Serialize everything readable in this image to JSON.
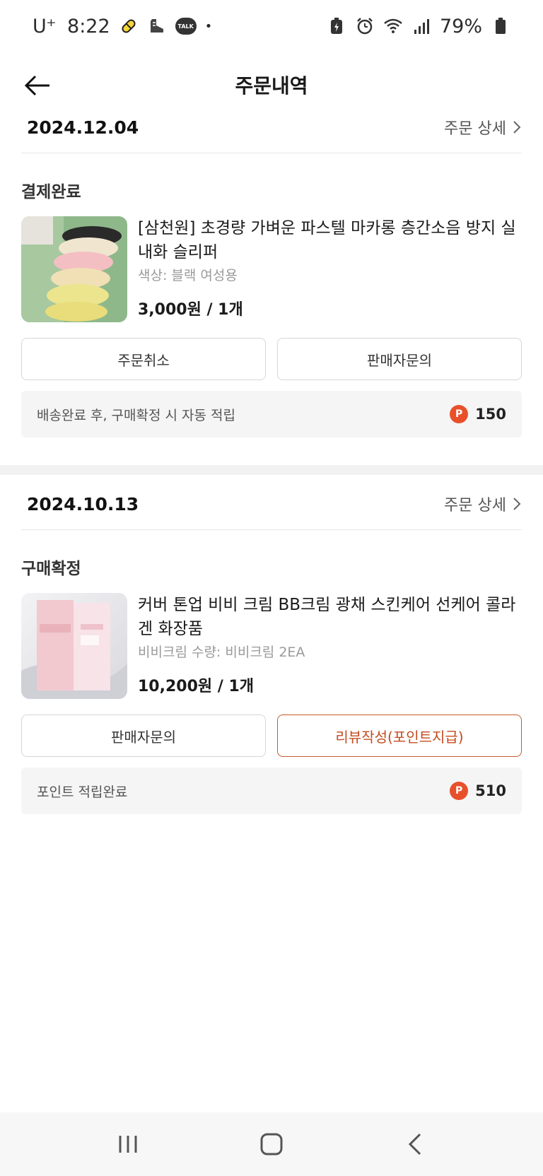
{
  "status_bar": {
    "carrier": "U⁺",
    "time": "8:22",
    "talk_badge": "TALK",
    "dot": "•",
    "battery_percent": "79%",
    "icons": [
      "pill-icon",
      "shoe-icon",
      "kakaotalk-icon",
      "battery-saver-icon",
      "alarm-icon",
      "wifi-icon",
      "signal-icon",
      "battery-icon"
    ]
  },
  "header": {
    "title": "주문내역"
  },
  "colors": {
    "accent": "#c44b1e",
    "point_badge": "#e8502a",
    "divider": "#f2f2f2",
    "points_bg": "#f5f5f5"
  },
  "orders": [
    {
      "date": "2024.12.04",
      "detail_label": "주문 상세",
      "status": "결제완료",
      "product_name": "[삼천원] 초경량 가벼운 파스텔 마카롱 층간소음 방지 실내화 슬리퍼",
      "option": "색상: 블랙 여성용",
      "price": "3,000원 / 1개",
      "buttons": [
        "주문취소",
        "판매자문의"
      ],
      "points_note": "배송완료 후, 구매확정 시 자동 적립",
      "point_badge": "P",
      "points": "150"
    },
    {
      "date": "2024.10.13",
      "detail_label": "주문 상세",
      "status": "구매확정",
      "product_name": "커버 톤업 비비 크림 BB크림 광채 스킨케어 선케어 콜라겐 화장품",
      "option": "비비크림 수량: 비비크림 2EA",
      "price": "10,200원 / 1개",
      "buttons": [
        "판매자문의",
        "리뷰작성(포인트지급)"
      ],
      "points_note": "포인트 적립완료",
      "point_badge": "P",
      "points": "510"
    }
  ]
}
